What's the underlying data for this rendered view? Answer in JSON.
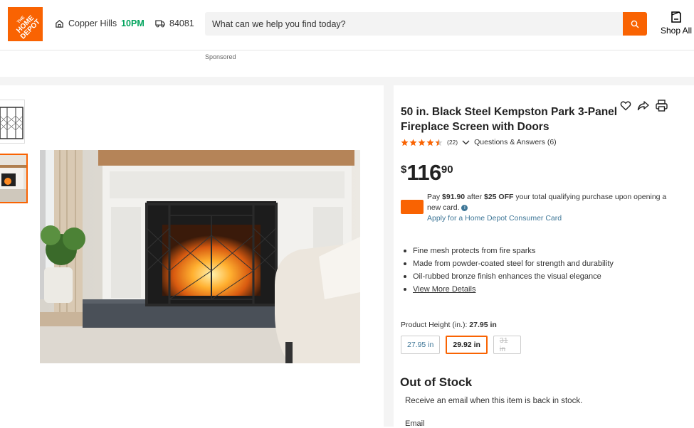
{
  "header": {
    "logo_text": "THE HOME DEPOT",
    "store_name": "Copper Hills",
    "store_hours": "10PM",
    "zip": "84081",
    "search_placeholder": "What can we help you find today?",
    "shop_all": "Shop All",
    "sponsored": "Sponsored"
  },
  "product": {
    "title": "50 in. Black Steel Kempston Park 3-Panel Fireplace Screen with Doors",
    "rating": 4.5,
    "review_count": "(22)",
    "qa_label": "Questions & Answers (6)",
    "price_currency": "$",
    "price_dollars": "116",
    "price_cents": "90",
    "promo_pay": "Pay ",
    "promo_amount": "$91.90",
    "promo_after": " after ",
    "promo_off": "$25 OFF",
    "promo_rest": " your total qualifying purchase upon opening a new card.",
    "apply_link": "Apply for a Home Depot Consumer Card",
    "bullets": [
      "Fine mesh protects from fire sparks",
      "Made from powder-coated steel for strength and durability",
      "Oil-rubbed bronze finish enhances the visual elegance"
    ],
    "view_more": "View More Details",
    "height_label": "Product Height (in.):",
    "height_value": "27.95 in",
    "height_options": [
      "27.95 in",
      "29.92 in",
      "31 in"
    ],
    "stock_status": "Out of Stock",
    "notify_text": "Receive an email when this item is back in stock.",
    "email_label": "Email"
  },
  "colors": {
    "brand": "#f96302",
    "link": "#3e7697",
    "open": "#00a35c"
  }
}
